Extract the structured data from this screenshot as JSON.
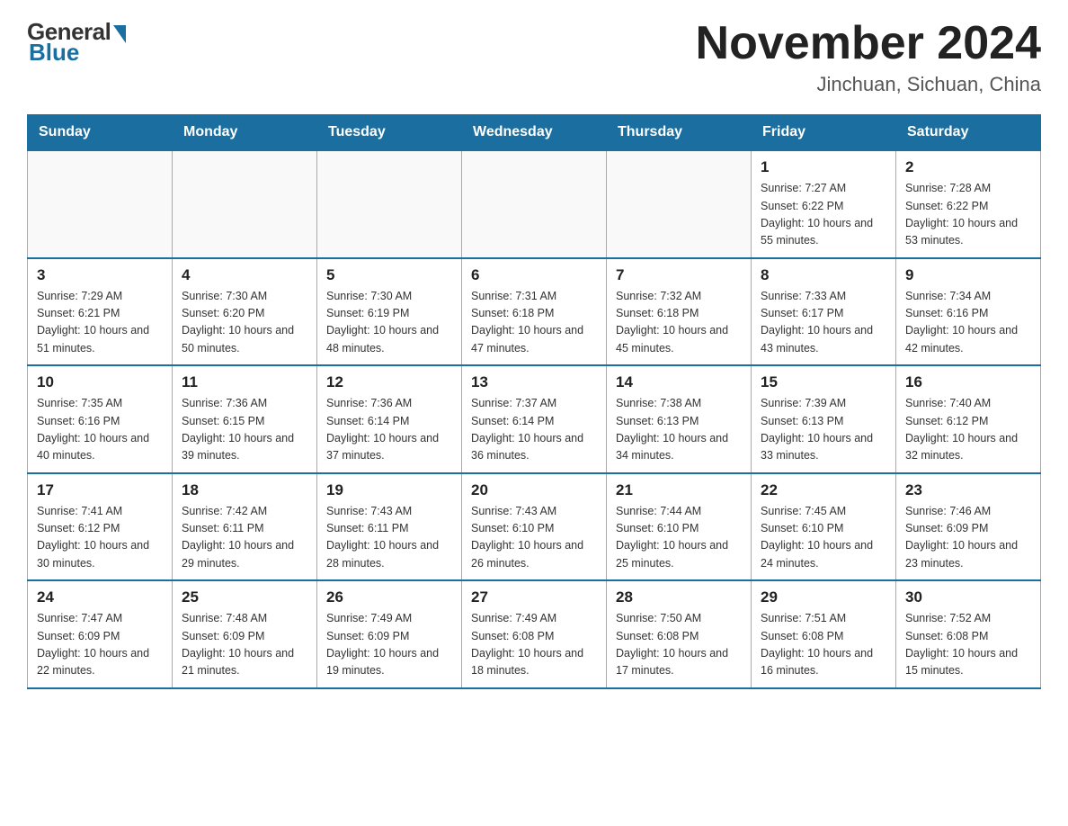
{
  "header": {
    "logo_general": "General",
    "logo_blue": "Blue",
    "month_title": "November 2024",
    "location": "Jinchuan, Sichuan, China"
  },
  "days_of_week": [
    "Sunday",
    "Monday",
    "Tuesday",
    "Wednesday",
    "Thursday",
    "Friday",
    "Saturday"
  ],
  "weeks": [
    [
      {
        "day": "",
        "info": ""
      },
      {
        "day": "",
        "info": ""
      },
      {
        "day": "",
        "info": ""
      },
      {
        "day": "",
        "info": ""
      },
      {
        "day": "",
        "info": ""
      },
      {
        "day": "1",
        "info": "Sunrise: 7:27 AM\nSunset: 6:22 PM\nDaylight: 10 hours and 55 minutes."
      },
      {
        "day": "2",
        "info": "Sunrise: 7:28 AM\nSunset: 6:22 PM\nDaylight: 10 hours and 53 minutes."
      }
    ],
    [
      {
        "day": "3",
        "info": "Sunrise: 7:29 AM\nSunset: 6:21 PM\nDaylight: 10 hours and 51 minutes."
      },
      {
        "day": "4",
        "info": "Sunrise: 7:30 AM\nSunset: 6:20 PM\nDaylight: 10 hours and 50 minutes."
      },
      {
        "day": "5",
        "info": "Sunrise: 7:30 AM\nSunset: 6:19 PM\nDaylight: 10 hours and 48 minutes."
      },
      {
        "day": "6",
        "info": "Sunrise: 7:31 AM\nSunset: 6:18 PM\nDaylight: 10 hours and 47 minutes."
      },
      {
        "day": "7",
        "info": "Sunrise: 7:32 AM\nSunset: 6:18 PM\nDaylight: 10 hours and 45 minutes."
      },
      {
        "day": "8",
        "info": "Sunrise: 7:33 AM\nSunset: 6:17 PM\nDaylight: 10 hours and 43 minutes."
      },
      {
        "day": "9",
        "info": "Sunrise: 7:34 AM\nSunset: 6:16 PM\nDaylight: 10 hours and 42 minutes."
      }
    ],
    [
      {
        "day": "10",
        "info": "Sunrise: 7:35 AM\nSunset: 6:16 PM\nDaylight: 10 hours and 40 minutes."
      },
      {
        "day": "11",
        "info": "Sunrise: 7:36 AM\nSunset: 6:15 PM\nDaylight: 10 hours and 39 minutes."
      },
      {
        "day": "12",
        "info": "Sunrise: 7:36 AM\nSunset: 6:14 PM\nDaylight: 10 hours and 37 minutes."
      },
      {
        "day": "13",
        "info": "Sunrise: 7:37 AM\nSunset: 6:14 PM\nDaylight: 10 hours and 36 minutes."
      },
      {
        "day": "14",
        "info": "Sunrise: 7:38 AM\nSunset: 6:13 PM\nDaylight: 10 hours and 34 minutes."
      },
      {
        "day": "15",
        "info": "Sunrise: 7:39 AM\nSunset: 6:13 PM\nDaylight: 10 hours and 33 minutes."
      },
      {
        "day": "16",
        "info": "Sunrise: 7:40 AM\nSunset: 6:12 PM\nDaylight: 10 hours and 32 minutes."
      }
    ],
    [
      {
        "day": "17",
        "info": "Sunrise: 7:41 AM\nSunset: 6:12 PM\nDaylight: 10 hours and 30 minutes."
      },
      {
        "day": "18",
        "info": "Sunrise: 7:42 AM\nSunset: 6:11 PM\nDaylight: 10 hours and 29 minutes."
      },
      {
        "day": "19",
        "info": "Sunrise: 7:43 AM\nSunset: 6:11 PM\nDaylight: 10 hours and 28 minutes."
      },
      {
        "day": "20",
        "info": "Sunrise: 7:43 AM\nSunset: 6:10 PM\nDaylight: 10 hours and 26 minutes."
      },
      {
        "day": "21",
        "info": "Sunrise: 7:44 AM\nSunset: 6:10 PM\nDaylight: 10 hours and 25 minutes."
      },
      {
        "day": "22",
        "info": "Sunrise: 7:45 AM\nSunset: 6:10 PM\nDaylight: 10 hours and 24 minutes."
      },
      {
        "day": "23",
        "info": "Sunrise: 7:46 AM\nSunset: 6:09 PM\nDaylight: 10 hours and 23 minutes."
      }
    ],
    [
      {
        "day": "24",
        "info": "Sunrise: 7:47 AM\nSunset: 6:09 PM\nDaylight: 10 hours and 22 minutes."
      },
      {
        "day": "25",
        "info": "Sunrise: 7:48 AM\nSunset: 6:09 PM\nDaylight: 10 hours and 21 minutes."
      },
      {
        "day": "26",
        "info": "Sunrise: 7:49 AM\nSunset: 6:09 PM\nDaylight: 10 hours and 19 minutes."
      },
      {
        "day": "27",
        "info": "Sunrise: 7:49 AM\nSunset: 6:08 PM\nDaylight: 10 hours and 18 minutes."
      },
      {
        "day": "28",
        "info": "Sunrise: 7:50 AM\nSunset: 6:08 PM\nDaylight: 10 hours and 17 minutes."
      },
      {
        "day": "29",
        "info": "Sunrise: 7:51 AM\nSunset: 6:08 PM\nDaylight: 10 hours and 16 minutes."
      },
      {
        "day": "30",
        "info": "Sunrise: 7:52 AM\nSunset: 6:08 PM\nDaylight: 10 hours and 15 minutes."
      }
    ]
  ]
}
